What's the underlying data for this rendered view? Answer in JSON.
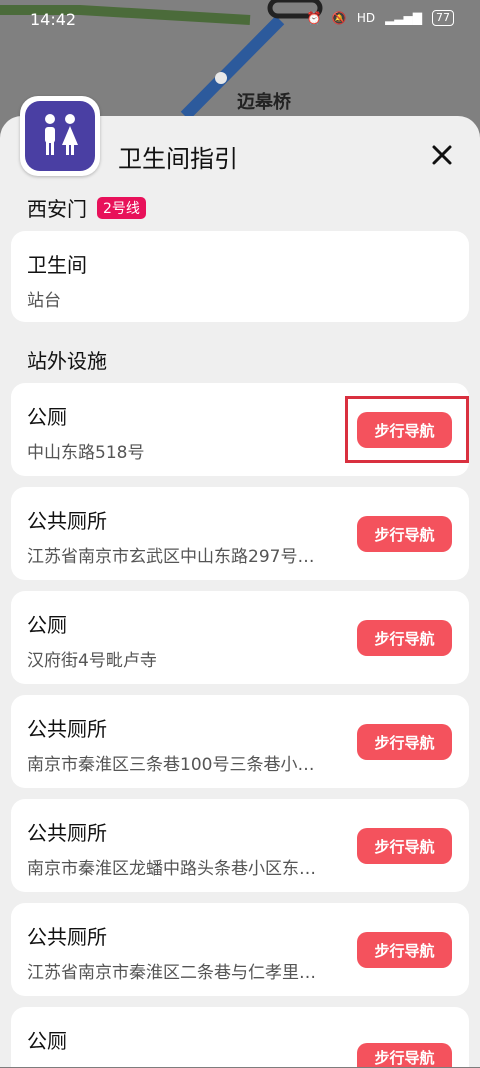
{
  "status_bar": {
    "time": "14:42",
    "icons_text": "HD",
    "battery": "77"
  },
  "map": {
    "station_label": "迈皋桥"
  },
  "sheet": {
    "title": "卫生间指引",
    "close_icon": "close-icon",
    "station": "西安门",
    "line_badge": "2号线",
    "toilet_card": {
      "title": "卫生间",
      "sub": "站台"
    },
    "section_label": "站外设施",
    "items": [
      {
        "title": "公厕",
        "address": "中山东路518号",
        "button": "步行导航"
      },
      {
        "title": "公共厕所",
        "address": "江苏省南京市玄武区中山东路297号…",
        "button": "步行导航"
      },
      {
        "title": "公厕",
        "address": "汉府街4号毗卢寺",
        "button": "步行导航"
      },
      {
        "title": "公共厕所",
        "address": "南京市秦淮区三条巷100号三条巷小…",
        "button": "步行导航"
      },
      {
        "title": "公共厕所",
        "address": "南京市秦淮区龙蟠中路头条巷小区东…",
        "button": "步行导航"
      },
      {
        "title": "公共厕所",
        "address": "江苏省南京市秦淮区二条巷与仁孝里…",
        "button": "步行导航"
      },
      {
        "title": "公厕",
        "address": "",
        "button": "步行导航"
      }
    ]
  },
  "colors": {
    "accent": "#f4525d",
    "badge": "#e8115a",
    "icon_bg": "#4a3fa3",
    "highlight": "#d9303f"
  }
}
